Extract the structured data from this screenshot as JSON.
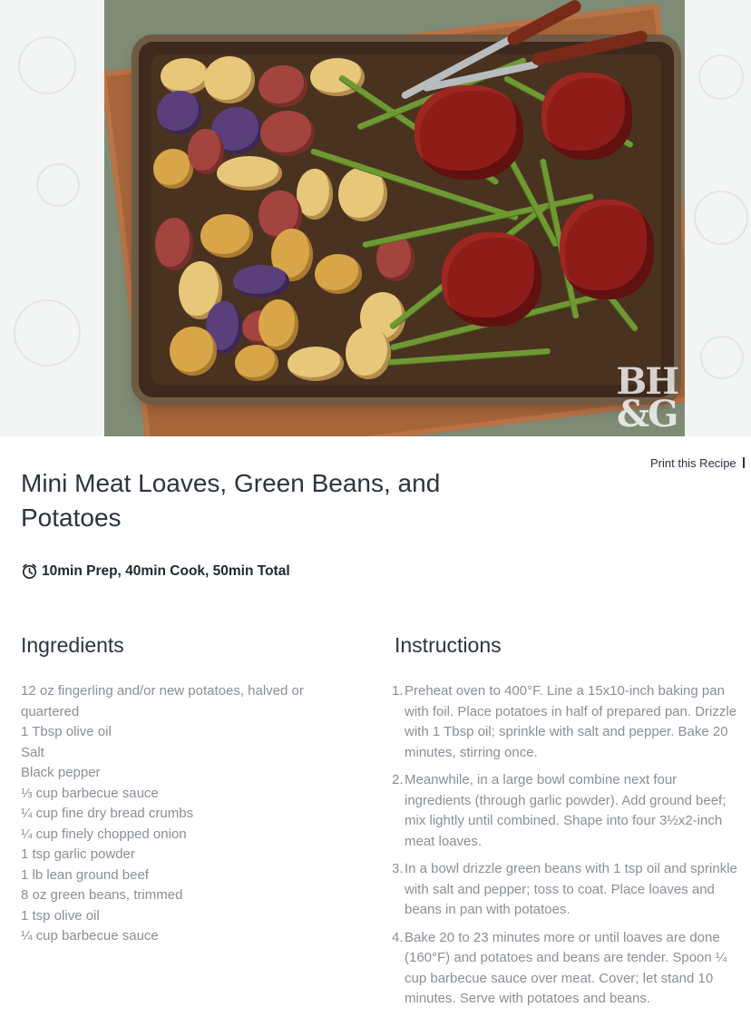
{
  "hero": {
    "watermark_line1": "BH",
    "watermark_line2": "&G"
  },
  "header": {
    "print_label": "Print this Recipe",
    "title": "Mini Meat Loaves, Green Beans, and Potatoes"
  },
  "timing": {
    "icon": "alarm-clock-icon",
    "text": "10min Prep, 40min Cook, 50min Total"
  },
  "ingredients": {
    "heading": "Ingredients",
    "items": [
      "12 oz fingerling and/or new potatoes, halved or quartered",
      "1 Tbsp olive oil",
      "Salt",
      "Black pepper",
      "⅓ cup barbecue sauce",
      "¼ cup fine dry bread crumbs",
      "¼ cup finely chopped onion",
      "1 tsp garlic powder",
      "1 lb lean ground beef",
      "8 oz green beans, trimmed",
      "1 tsp olive oil",
      "¼ cup barbecue sauce"
    ]
  },
  "instructions": {
    "heading": "Instructions",
    "steps": [
      {
        "num": "1.",
        "text": "Preheat oven to 400°F. Line a 15x10-inch baking pan with foil. Place potatoes in half of prepared pan. Drizzle with 1 Tbsp oil; sprinkle with salt and pepper. Bake 20 minutes, stirring once."
      },
      {
        "num": "2.",
        "text": "Meanwhile, in a large bowl combine next four ingredients (through garlic powder). Add ground beef; mix lightly until combined. Shape into four 3½x2-inch meat loaves."
      },
      {
        "num": "3.",
        "text": "In a bowl drizzle green beans with 1 tsp oil and sprinkle with salt and pepper; toss to coat. Place loaves and beans in pan with potatoes."
      },
      {
        "num": "4.",
        "text": "Bake 20 to 23 minutes more or until loaves are done (160°F) and potatoes and beans are tender. Spoon ¼ cup barbecue sauce over meat. Cover; let stand 10 minutes. Serve with potatoes and beans."
      }
    ]
  }
}
